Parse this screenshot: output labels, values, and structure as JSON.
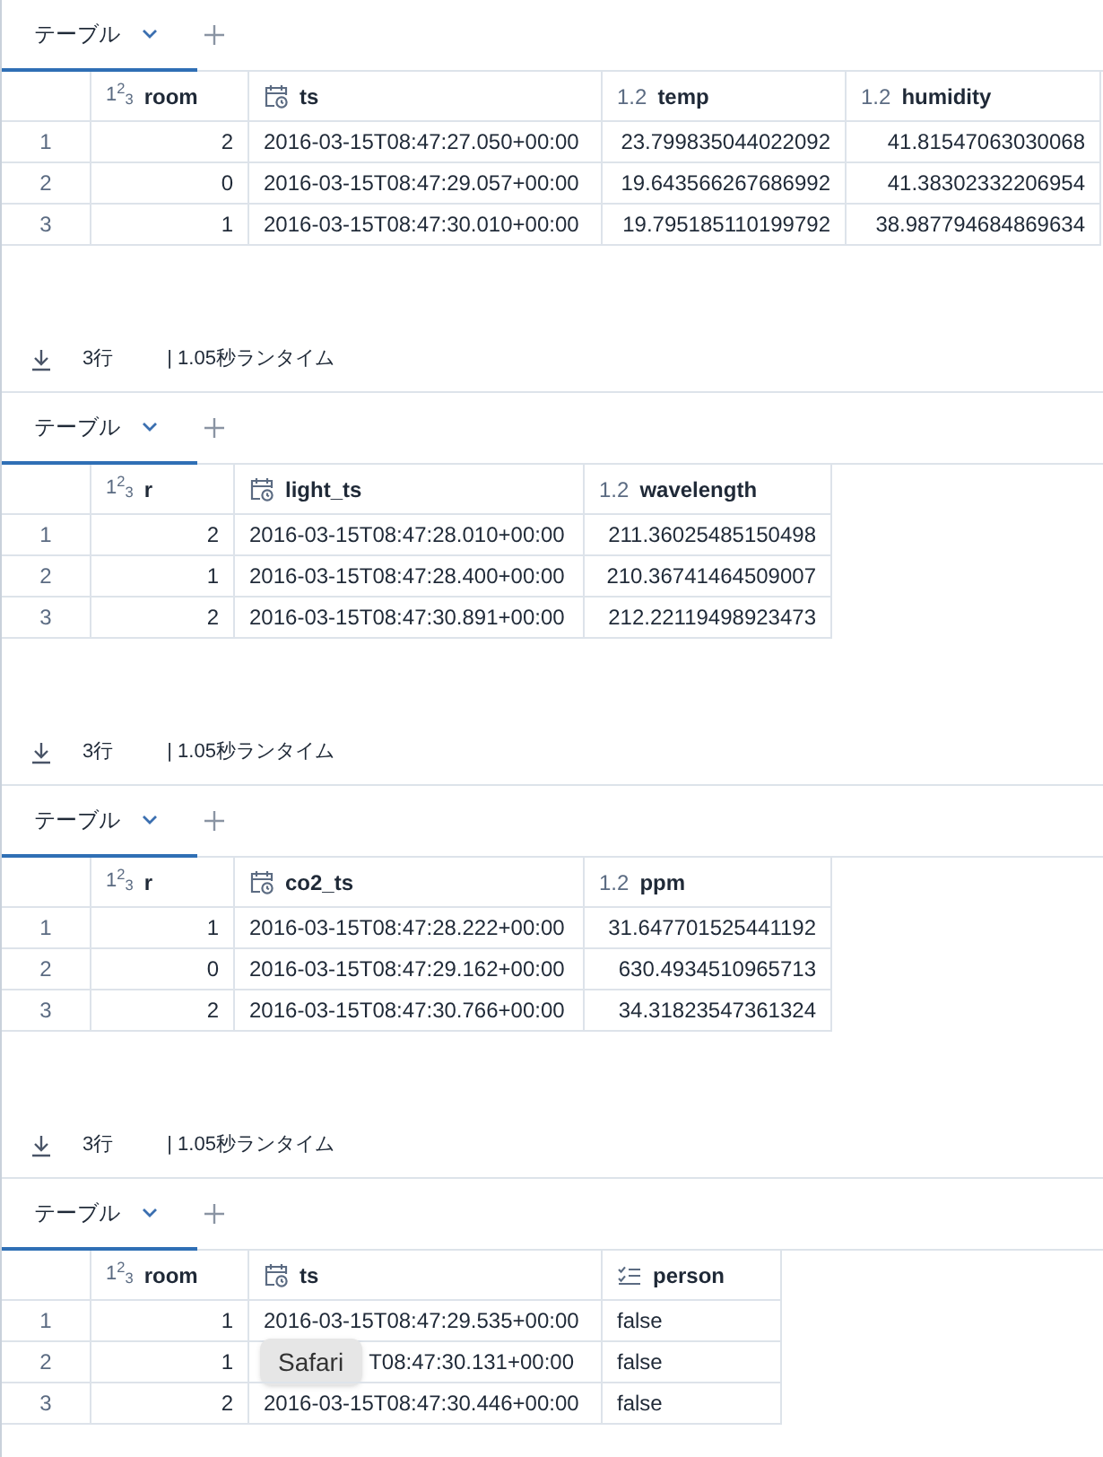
{
  "sections": [
    {
      "tabs": [
        {
          "label": "テーブル",
          "selected": true
        }
      ],
      "table": {
        "columns": [
          {
            "name": "room",
            "kind": "integer",
            "type_label": "1$^{2}$$_{3}$"
          },
          {
            "name": "ts",
            "kind": "timestamp"
          },
          {
            "name": "temp",
            "kind": "double",
            "type_label": "1.2"
          },
          {
            "name": "humidity",
            "kind": "double",
            "type_label": "1.2"
          }
        ],
        "rows": [
          {
            "index": "1",
            "cells": [
              "2",
              "2016-03-15T08:47:27.050+00:00",
              "23.799835044022092",
              "41.81547063030068"
            ]
          },
          {
            "index": "2",
            "cells": [
              "0",
              "2016-03-15T08:47:29.057+00:00",
              "19.643566267686992",
              "41.38302332206954"
            ]
          },
          {
            "index": "3",
            "cells": [
              "1",
              "2016-03-15T08:47:30.010+00:00",
              "19.795185110199792",
              "38.987794684869634"
            ]
          }
        ]
      },
      "footer": {
        "row_count": "3行",
        "runtime": "| 1.05秒ランタイム"
      }
    },
    {
      "tabs": [
        {
          "label": "テーブル",
          "selected": true
        }
      ],
      "table": {
        "columns": [
          {
            "name": "r",
            "kind": "integer",
            "type_label": "1$^{2}$$_{3}$"
          },
          {
            "name": "light_ts",
            "kind": "timestamp"
          },
          {
            "name": "wavelength",
            "kind": "double",
            "type_label": "1.2"
          }
        ],
        "rows": [
          {
            "index": "1",
            "cells": [
              "2",
              "2016-03-15T08:47:28.010+00:00",
              "211.36025485150498"
            ]
          },
          {
            "index": "2",
            "cells": [
              "1",
              "2016-03-15T08:47:28.400+00:00",
              "210.36741464509007"
            ]
          },
          {
            "index": "3",
            "cells": [
              "2",
              "2016-03-15T08:47:30.891+00:00",
              "212.22119498923473"
            ]
          }
        ]
      },
      "footer": {
        "row_count": "3行",
        "runtime": "| 1.05秒ランタイム"
      }
    },
    {
      "tabs": [
        {
          "label": "テーブル",
          "selected": true
        }
      ],
      "table": {
        "columns": [
          {
            "name": "r",
            "kind": "integer",
            "type_label": "1$^{2}$$_{3}$"
          },
          {
            "name": "co2_ts",
            "kind": "timestamp"
          },
          {
            "name": "ppm",
            "kind": "double",
            "type_label": "1.2"
          }
        ],
        "rows": [
          {
            "index": "1",
            "cells": [
              "1",
              "2016-03-15T08:47:28.222+00:00",
              "31.647701525441192"
            ]
          },
          {
            "index": "2",
            "cells": [
              "0",
              "2016-03-15T08:47:29.162+00:00",
              "630.4934510965713"
            ]
          },
          {
            "index": "3",
            "cells": [
              "2",
              "2016-03-15T08:47:30.766+00:00",
              "34.31823547361324"
            ]
          }
        ]
      },
      "footer": {
        "row_count": "3行",
        "runtime": "| 1.05秒ランタイム"
      }
    },
    {
      "tabs": [
        {
          "label": "テーブル",
          "selected": true
        }
      ],
      "table": {
        "columns": [
          {
            "name": "room",
            "kind": "integer",
            "type_label": "1$^{2}$$_{3}$"
          },
          {
            "name": "ts",
            "kind": "timestamp"
          },
          {
            "name": "person",
            "kind": "boolean"
          }
        ],
        "rows": [
          {
            "index": "1",
            "cells": [
              "1",
              "2016-03-15T08:47:29.535+00:00",
              "false"
            ]
          },
          {
            "index": "2",
            "cells": [
              "1",
              "T08:47:30.131+00:00",
              "false"
            ],
            "tooltip": "Safari"
          },
          {
            "index": "3",
            "cells": [
              "2",
              "2016-03-15T08:47:30.446+00:00",
              "false"
            ]
          }
        ]
      }
    }
  ]
}
